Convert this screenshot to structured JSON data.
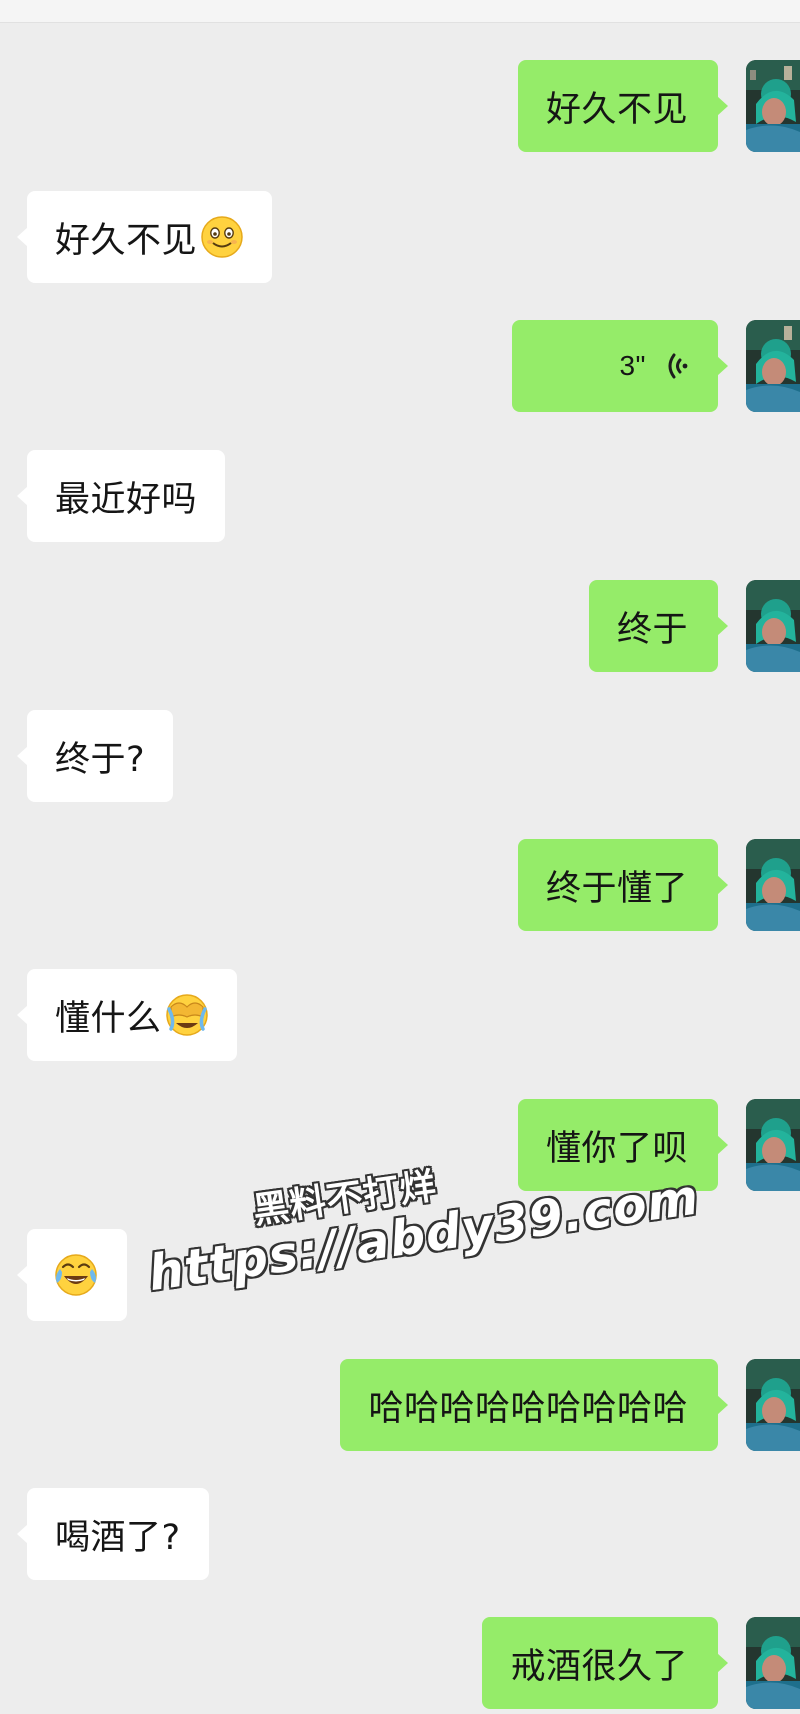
{
  "colors": {
    "background": "#ededed",
    "outgoing_bubble": "#95ec69",
    "incoming_bubble": "#ffffff",
    "text": "#151515"
  },
  "messages": [
    {
      "side": "out",
      "type": "text",
      "text": "好久不见"
    },
    {
      "side": "in",
      "type": "text",
      "text": "好久不见",
      "emoji": "smile-emoji"
    },
    {
      "side": "out",
      "type": "voice",
      "duration": "3\"",
      "icon": "voice-wave-icon"
    },
    {
      "side": "in",
      "type": "text",
      "text": "最近好吗"
    },
    {
      "side": "out",
      "type": "text",
      "text": "终于"
    },
    {
      "side": "in",
      "type": "text",
      "text": "终于?"
    },
    {
      "side": "out",
      "type": "text",
      "text": "终于懂了"
    },
    {
      "side": "in",
      "type": "text",
      "text": "懂什么",
      "emoji": "facepalm-emoji"
    },
    {
      "side": "out",
      "type": "text",
      "text": "懂你了呗"
    },
    {
      "side": "in",
      "type": "emoji",
      "emoji": "tears-of-joy-emoji"
    },
    {
      "side": "out",
      "type": "text",
      "text": "哈哈哈哈哈哈哈哈哈"
    },
    {
      "side": "in",
      "type": "text",
      "text": "喝酒了?"
    },
    {
      "side": "out",
      "type": "text",
      "text": "戒酒很久了"
    }
  ],
  "watermark": {
    "line1": "黑料不打烊",
    "line2": "https://abdy39.com"
  }
}
